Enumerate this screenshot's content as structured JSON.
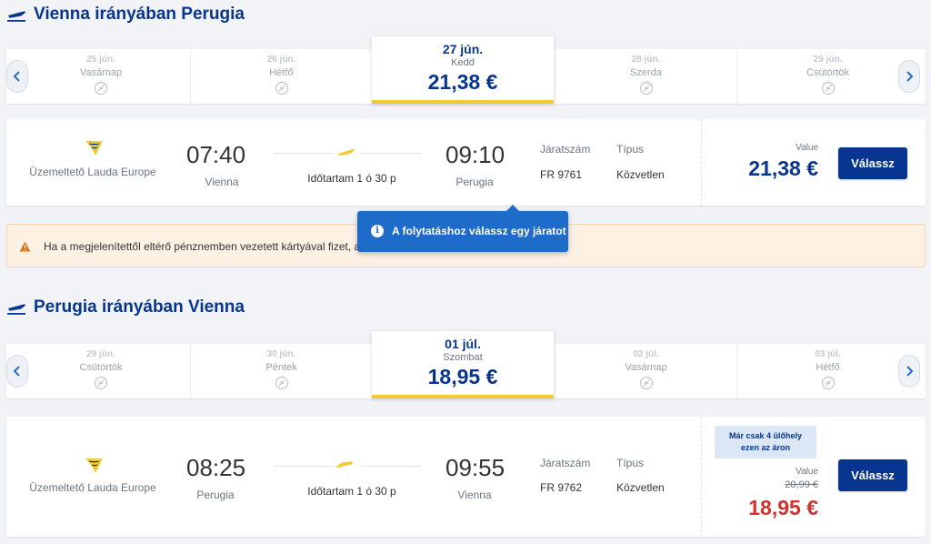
{
  "sections": [
    {
      "title": "Vienna irányában Perugia",
      "days_left": [
        {
          "date": "25 jún.",
          "weekday": "Vasárnap"
        },
        {
          "date": "26 jún.",
          "weekday": "Hétfő"
        }
      ],
      "selected": {
        "date": "27 jún.",
        "weekday": "Kedd",
        "price": "21,38 €"
      },
      "days_right": [
        {
          "date": "28 jún.",
          "weekday": "Szerda"
        },
        {
          "date": "29 jún.",
          "weekday": "Csütörtök"
        }
      ],
      "flight": {
        "operator": "Üzemeltető Lauda Europe",
        "dep_time": "07:40",
        "dep_place": "Vienna",
        "duration": "Időtartam 1 ó 30 p",
        "arr_time": "09:10",
        "arr_place": "Perugia",
        "flight_no_label": "Járatszám",
        "flight_no": "FR 9761",
        "type_label": "Típus",
        "type": "Közvetlen",
        "price_label": "Value",
        "price": "21,38 €",
        "select_label": "Válassz"
      }
    },
    {
      "title": "Perugia irányában Vienna",
      "days_left": [
        {
          "date": "29 jún.",
          "weekday": "Csütörtök"
        },
        {
          "date": "30 jún.",
          "weekday": "Péntek"
        }
      ],
      "selected": {
        "date": "01 júl.",
        "weekday": "Szombat",
        "price": "18,95 €"
      },
      "days_right": [
        {
          "date": "02 júl.",
          "weekday": "Vasárnap"
        },
        {
          "date": "03 júl.",
          "weekday": "Hétfő"
        }
      ],
      "flight": {
        "operator": "Üzemeltető Lauda Europe",
        "dep_time": "08:25",
        "dep_place": "Perugia",
        "duration": "Időtartam 1 ó 30 p",
        "arr_time": "09:55",
        "arr_place": "Vienna",
        "flight_no_label": "Járatszám",
        "flight_no": "FR 9762",
        "type_label": "Típus",
        "type": "Közvetlen",
        "promo_line1": "Már csak 4 ülőhely",
        "promo_line2": "ezen az áron",
        "price_label": "Value",
        "old_price": "20,99 €",
        "price": "18,95 €",
        "select_label": "Válassz"
      }
    }
  ],
  "warning": "Ha a megjelenítettől eltérő pénznemben vezetett kártyával fizet, a",
  "tooltip": "A folytatáshoz válassz egy járatot",
  "colors": {
    "brand": "#073590",
    "accent": "#f1c931",
    "sale_price": "#d0332e",
    "tooltip": "#1e6cc9",
    "warning_bg": "#fdf1e3"
  }
}
